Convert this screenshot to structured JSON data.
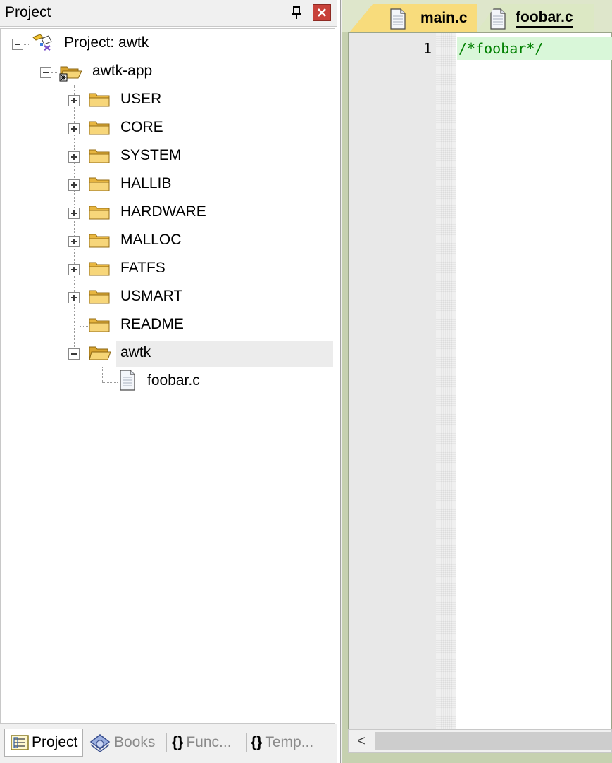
{
  "panel": {
    "title": "Project",
    "pin_glyph": "pin-icon",
    "close_glyph": "close-icon"
  },
  "tree": {
    "root": {
      "label": "Project: awtk",
      "icon": "project-icon",
      "expanded": true
    },
    "target": {
      "label": "awtk-app",
      "icon": "open-folder-icon",
      "expanded": true
    },
    "groups": [
      {
        "label": "USER",
        "icon": "folder-icon",
        "expandable": true
      },
      {
        "label": "CORE",
        "icon": "folder-icon",
        "expandable": true
      },
      {
        "label": "SYSTEM",
        "icon": "folder-icon",
        "expandable": true
      },
      {
        "label": "HALLIB",
        "icon": "folder-icon",
        "expandable": true
      },
      {
        "label": "HARDWARE",
        "icon": "folder-icon",
        "expandable": true
      },
      {
        "label": "MALLOC",
        "icon": "folder-icon",
        "expandable": true
      },
      {
        "label": "FATFS",
        "icon": "folder-icon",
        "expandable": true
      },
      {
        "label": "USMART",
        "icon": "folder-icon",
        "expandable": true
      },
      {
        "label": "README",
        "icon": "folder-icon",
        "expandable": false
      }
    ],
    "selected_group": {
      "label": "awtk",
      "icon": "open-folder-icon",
      "expanded": true
    },
    "file": {
      "label": "foobar.c",
      "icon": "file-icon"
    }
  },
  "bottom_tabs": [
    {
      "label": "Project",
      "icon": "project-tab-icon",
      "active": true
    },
    {
      "label": "Books",
      "icon": "books-icon",
      "active": false
    },
    {
      "label": "Func...",
      "icon": "braces-icon",
      "icon_text": "{}",
      "active": false
    },
    {
      "label": "Temp...",
      "icon": "template-icon",
      "icon_text": "{}",
      "active": false
    }
  ],
  "editor": {
    "tabs": [
      {
        "label": "main.c",
        "active": false,
        "color": "#f8dc7c"
      },
      {
        "label": "foobar.c",
        "active": true,
        "color": "#dce8c4"
      }
    ],
    "line_number": "1",
    "code": "/*foobar*/",
    "comment_color": "#008000",
    "scroll_left_glyph": "<"
  }
}
